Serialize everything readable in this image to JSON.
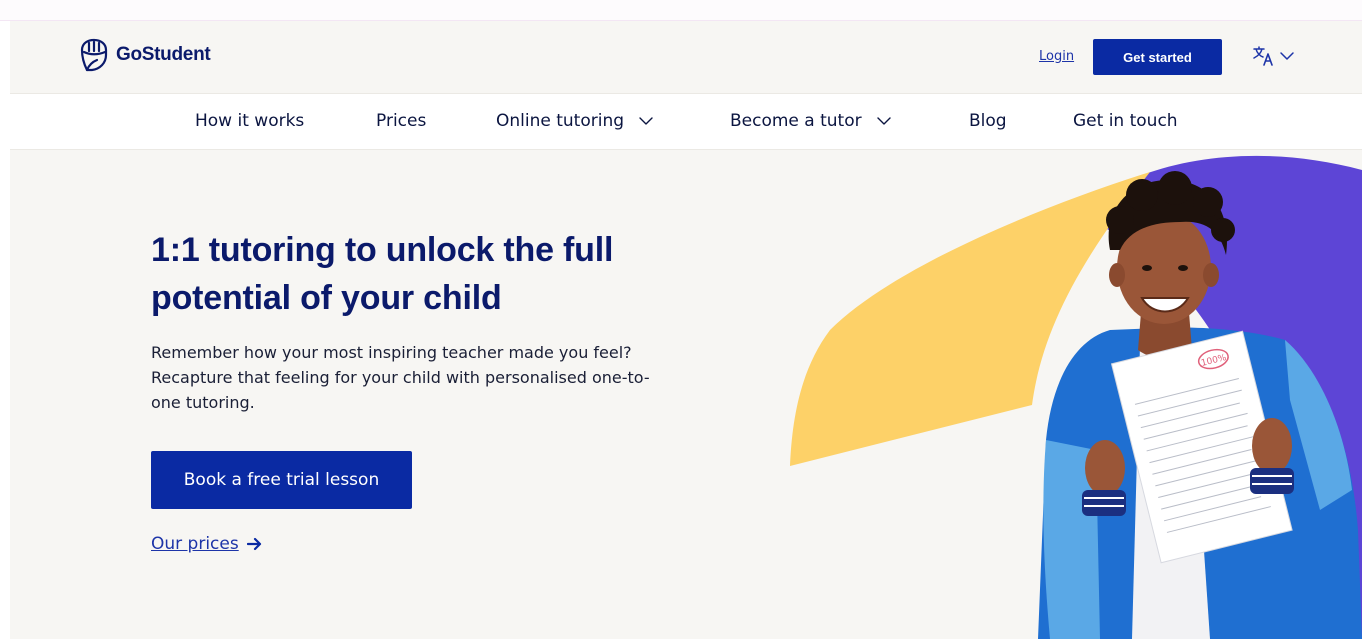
{
  "brand": {
    "name": "GoStudent",
    "primary_color": "#0a2aa3",
    "heading_color": "#0b1a6b",
    "accent_yellow": "#fdd168",
    "accent_purple": "#5d45d6"
  },
  "header": {
    "login_label": "Login",
    "get_started_label": "Get started",
    "language_icon": "translate-icon"
  },
  "nav": {
    "items": [
      {
        "label": "How it works",
        "has_dropdown": false
      },
      {
        "label": "Prices",
        "has_dropdown": false
      },
      {
        "label": "Online tutoring",
        "has_dropdown": true
      },
      {
        "label": "Become a tutor",
        "has_dropdown": true
      },
      {
        "label": "Blog",
        "has_dropdown": false
      },
      {
        "label": "Get in touch",
        "has_dropdown": false
      }
    ]
  },
  "hero": {
    "headline": "1:1 tutoring to unlock the full potential of your child",
    "subtext": "Remember how your most inspiring teacher made you feel? Recapture that feeling for your child with personalised one-to-one tutoring.",
    "cta_label": "Book a free trial lesson",
    "secondary_link_label": "Our prices",
    "image": {
      "subject": "smiling boy in blue jacket holding a test paper",
      "paper_mark": "100%"
    }
  }
}
